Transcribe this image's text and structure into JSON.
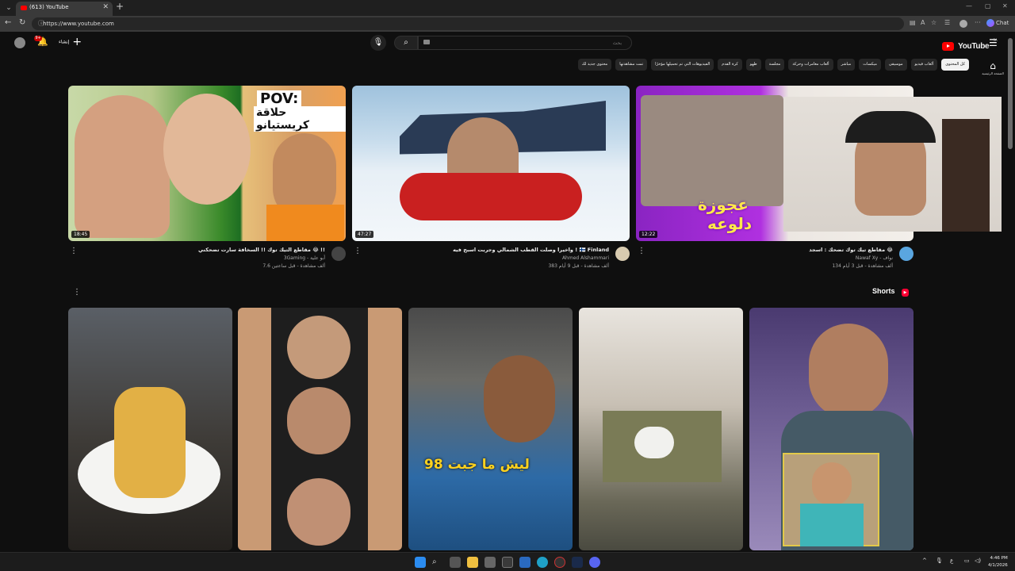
{
  "browser": {
    "tab_title": "(613) YouTube",
    "url": "https://www.youtube.com",
    "chat_label": "Chat"
  },
  "header": {
    "search_placeholder": "بحث",
    "create_label": "إنشاء",
    "notification_count": "9+",
    "logo_text": "YouTube",
    "country_code": "SA"
  },
  "guide": {
    "home_label": "الصفحة الرئيسية"
  },
  "chips": [
    "كل المحتوى",
    "ألعاب فيديو",
    "موسيقى",
    "ميكسات",
    "مباشر",
    "ألعاب مغامرات وحركة",
    "مجلسة",
    "طهو",
    "كرة القدم",
    "الفيديوهات التي تم تحميلها مؤخرًا",
    "تمت مشاهدتها",
    "محتوى جديد لك"
  ],
  "videos": [
    {
      "title": "مقاطع التيك توك !! السخافة سارت تضحكني 😂 !!",
      "channel": "3Gaming - أبو علية",
      "stats": "7.6 ألف مشاهدة - قبل ساعتين",
      "duration": "18:45",
      "avatar_color": "#444444"
    },
    {
      "title": "واخيرا وصلت القطب الشمالي وجربت اسبح فيه ! 🇫🇮 Finland",
      "channel": "Ahmed Alshammari",
      "stats": "383 ألف مشاهدة - قبل 9 أيام",
      "duration": "47:27",
      "avatar_color": "#d8cbb0"
    },
    {
      "title": "مقاطع تيك توك تضحك : اسجد 😂",
      "channel": "Nawaf Xy - نواف",
      "stats": "134 ألف مشاهدة - قبل 3 أيام",
      "duration": "12:22",
      "avatar_color": "#5aa6e0"
    }
  ],
  "shorts": {
    "heading": "Shorts",
    "overlay_text": "ليش ما جبت 98"
  },
  "thumb_text": {
    "pov": "POV:",
    "pov_line": "حلاقة كريستيانو",
    "old_woman": "عجوزة",
    "old_woman2": "دلوعه"
  },
  "taskbar": {
    "time": "4:46 PM",
    "date": "4/1/2026"
  }
}
